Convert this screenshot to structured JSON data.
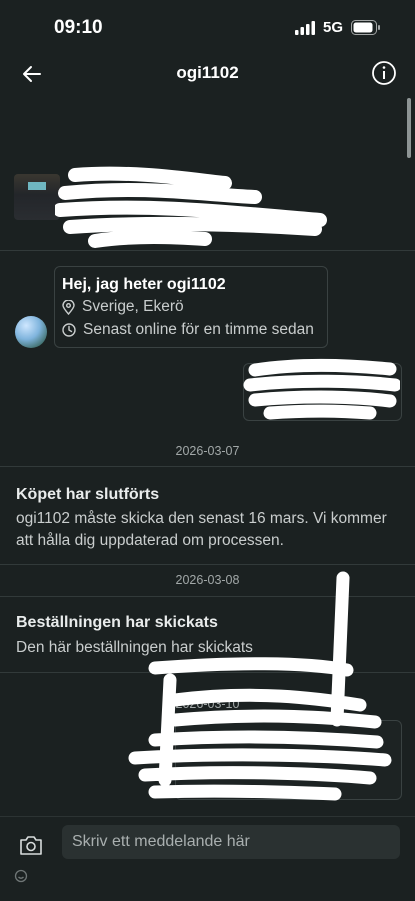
{
  "status": {
    "time": "09:10",
    "network": "5G"
  },
  "header": {
    "title": "ogi1102"
  },
  "profile": {
    "greeting": "Hej, jag heter ogi1102",
    "location": "Sverige, Ekerö",
    "last_online": "Senast online för en timme sedan"
  },
  "events": [
    {
      "date": "2026-03-07",
      "title": "Köpet har slutförts",
      "text": "ogi1102 måste skicka den senast 16 mars. Vi kommer att hålla dig uppdaterad om processen."
    },
    {
      "date": "2026-03-08",
      "title": "Beställningen har skickats",
      "text": "Den här beställningen har skickats"
    },
    {
      "date": "2026-03-10"
    }
  ],
  "composer": {
    "placeholder": "Skriv ett meddelande här"
  },
  "colors": {
    "background": "#1b2121",
    "border": "#3a4242",
    "text": "#e6e8e8",
    "muted": "#a2a8a8"
  },
  "icons": [
    "back-arrow-icon",
    "info-icon",
    "location-pin-icon",
    "clock-icon",
    "camera-icon"
  ]
}
